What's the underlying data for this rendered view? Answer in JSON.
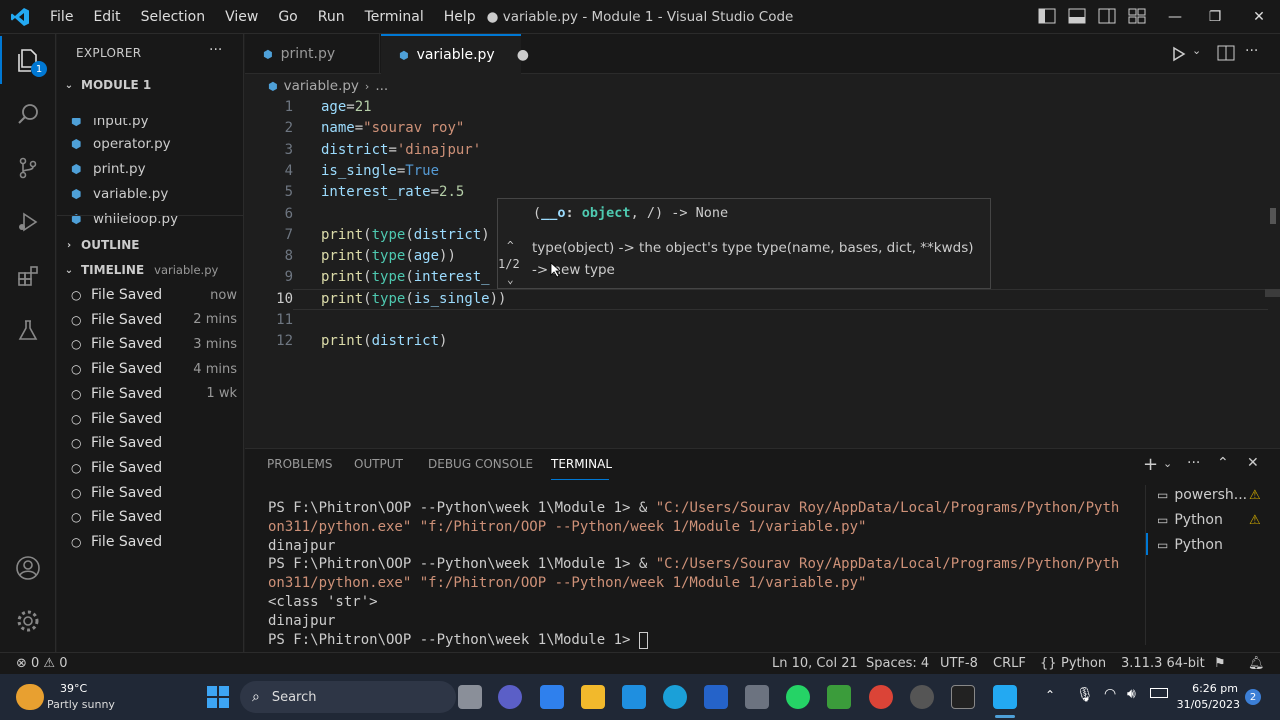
{
  "window": {
    "title": "● variable.py - Module 1 - Visual Studio Code",
    "menu": [
      "File",
      "Edit",
      "Selection",
      "View",
      "Go",
      "Run",
      "Terminal",
      "Help"
    ]
  },
  "activity": {
    "explorer_badge": "1"
  },
  "sidebar": {
    "header": "EXPLORER",
    "section": "MODULE 1",
    "files": [
      "input.py",
      "operator.py",
      "print.py",
      "variable.py",
      "whileloop.py"
    ],
    "outline": "OUTLINE",
    "timeline": "TIMELINE",
    "timeline_file": "variable.py",
    "timeline_items": [
      {
        "label": "File Saved",
        "time": "now"
      },
      {
        "label": "File Saved",
        "time": "2 mins"
      },
      {
        "label": "File Saved",
        "time": "3 mins"
      },
      {
        "label": "File Saved",
        "time": "4 mins"
      },
      {
        "label": "File Saved",
        "time": "1 wk"
      },
      {
        "label": "File Saved",
        "time": ""
      },
      {
        "label": "File Saved",
        "time": ""
      },
      {
        "label": "File Saved",
        "time": ""
      },
      {
        "label": "File Saved",
        "time": ""
      },
      {
        "label": "File Saved",
        "time": ""
      },
      {
        "label": "File Saved",
        "time": ""
      }
    ]
  },
  "tabs": [
    {
      "label": "print.py"
    },
    {
      "label": "variable.py"
    }
  ],
  "breadcrumb": {
    "file": "variable.py",
    "rest": "..."
  },
  "editor": {
    "lines": [
      [
        [
          "k",
          "age"
        ],
        [
          "",
          "="
        ],
        [
          "n",
          "21"
        ]
      ],
      [
        [
          "k",
          "name"
        ],
        [
          "",
          "="
        ],
        [
          "s",
          "\"sourav roy\""
        ]
      ],
      [
        [
          "k",
          "district"
        ],
        [
          "",
          "="
        ],
        [
          "s",
          "'dinajpur'"
        ]
      ],
      [
        [
          "k",
          "is_single"
        ],
        [
          "",
          "="
        ],
        [
          "b",
          "True"
        ]
      ],
      [
        [
          "k",
          "interest_rate"
        ],
        [
          "",
          "="
        ],
        [
          "n",
          "2.5"
        ]
      ],
      [],
      [
        [
          "f",
          "print"
        ],
        [
          "",
          "("
        ],
        [
          "c",
          "type"
        ],
        [
          "",
          "("
        ],
        [
          "k",
          "district"
        ],
        [
          "",
          ")"
        ]
      ],
      [
        [
          "f",
          "print"
        ],
        [
          "",
          "("
        ],
        [
          "c",
          "type"
        ],
        [
          "",
          "("
        ],
        [
          "k",
          "age"
        ],
        [
          "",
          "))"
        ]
      ],
      [
        [
          "f",
          "print"
        ],
        [
          "",
          "("
        ],
        [
          "c",
          "type"
        ],
        [
          "",
          "("
        ],
        [
          "k",
          "interest_"
        ]
      ],
      [
        [
          "f",
          "print"
        ],
        [
          "",
          "("
        ],
        [
          "c",
          "type"
        ],
        [
          "",
          "("
        ],
        [
          "k",
          "is_single"
        ],
        [
          "",
          "))"
        ]
      ],
      [],
      [
        [
          "f",
          "print"
        ],
        [
          "",
          "("
        ],
        [
          "k",
          "district"
        ],
        [
          "",
          ")"
        ]
      ]
    ]
  },
  "hover": {
    "signature_param": "__o",
    "signature_type": "object",
    "signature_tail": ", /) -> None",
    "counter": "1/2",
    "doc_line1": "type(object) -> the object's type type(name, bases, dict, **kwds)",
    "doc_line2": "-> new type"
  },
  "panel": {
    "tabs": [
      "PROBLEMS",
      "OUTPUT",
      "DEBUG CONSOLE",
      "TERMINAL"
    ],
    "terminal": [
      [
        [
          "",
          "PS F:\\Phitron\\OOP --Python\\week 1\\Module 1> & "
        ],
        [
          "s",
          "\"C:/Users/Sourav Roy/AppData/Local/Programs/Python/Pyth"
        ]
      ],
      [
        [
          "s",
          "on311/python.exe\" \"f:/Phitron/OOP --Python/week 1/Module 1/variable.py\""
        ]
      ],
      [
        [
          "",
          "dinajpur"
        ]
      ],
      [
        [
          "",
          "PS F:\\Phitron\\OOP --Python\\week 1\\Module 1> & "
        ],
        [
          "s",
          "\"C:/Users/Sourav Roy/AppData/Local/Programs/Python/Pyth"
        ]
      ],
      [
        [
          "s",
          "on311/python.exe\" \"f:/Phitron/OOP --Python/week 1/Module 1/variable.py\""
        ]
      ],
      [
        [
          "",
          "<class 'str'>"
        ]
      ],
      [
        [
          "",
          "dinajpur"
        ]
      ],
      [
        [
          "",
          "PS F:\\Phitron\\OOP --Python\\week 1\\Module 1> "
        ]
      ]
    ],
    "sessions": [
      "powersh...",
      "Python",
      "Python"
    ]
  },
  "status": {
    "problems": "⊗ 0 ⚠ 0",
    "position": "Ln 10, Col 21",
    "spaces": "Spaces: 4",
    "encoding": "UTF-8",
    "eol": "CRLF",
    "language": "Python",
    "interpreter": "3.11.3 64-bit"
  },
  "taskbar": {
    "weather_temp": "39°C",
    "weather_desc": "Partly sunny",
    "search": "Search",
    "time": "6:26 pm",
    "date": "31/05/2023",
    "notif": "2"
  },
  "colors": {
    "accent": "#0078d4",
    "string": "#ce9178",
    "variable": "#9cdcfe"
  }
}
